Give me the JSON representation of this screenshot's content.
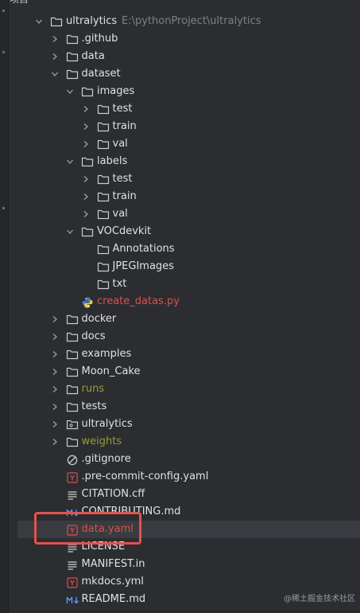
{
  "top_cut_text": "项目",
  "root": {
    "name": "ultralytics",
    "path": "E:\\pythonProject\\ultralytics"
  },
  "items": [
    {
      "label": "ultralytics",
      "hint": "E:\\pythonProject\\ultralytics",
      "depth": 0,
      "chevron": "down",
      "icon": "folder",
      "style": "normal"
    },
    {
      "label": ".github",
      "depth": 1,
      "chevron": "right",
      "icon": "folder",
      "style": "normal"
    },
    {
      "label": "data",
      "depth": 1,
      "chevron": "right",
      "icon": "folder",
      "style": "normal"
    },
    {
      "label": "dataset",
      "depth": 1,
      "chevron": "down",
      "icon": "folder",
      "style": "normal"
    },
    {
      "label": "images",
      "depth": 2,
      "chevron": "down",
      "icon": "folder",
      "style": "normal"
    },
    {
      "label": "test",
      "depth": 3,
      "chevron": "right",
      "icon": "folder",
      "style": "normal"
    },
    {
      "label": "train",
      "depth": 3,
      "chevron": "right",
      "icon": "folder",
      "style": "normal"
    },
    {
      "label": "val",
      "depth": 3,
      "chevron": "right",
      "icon": "folder",
      "style": "normal"
    },
    {
      "label": "labels",
      "depth": 2,
      "chevron": "down",
      "icon": "folder",
      "style": "normal"
    },
    {
      "label": "test",
      "depth": 3,
      "chevron": "right",
      "icon": "folder",
      "style": "normal"
    },
    {
      "label": "train",
      "depth": 3,
      "chevron": "right",
      "icon": "folder",
      "style": "normal"
    },
    {
      "label": "val",
      "depth": 3,
      "chevron": "right",
      "icon": "folder",
      "style": "normal"
    },
    {
      "label": "VOCdevkit",
      "depth": 2,
      "chevron": "down",
      "icon": "folder",
      "style": "normal"
    },
    {
      "label": "Annotations",
      "depth": 3,
      "chevron": "none",
      "icon": "folder",
      "style": "normal"
    },
    {
      "label": "JPEGImages",
      "depth": 3,
      "chevron": "none",
      "icon": "folder",
      "style": "normal"
    },
    {
      "label": "txt",
      "depth": 3,
      "chevron": "none",
      "icon": "folder",
      "style": "normal"
    },
    {
      "label": "create_datas.py",
      "depth": 2,
      "chevron": "none",
      "icon": "python",
      "style": "red"
    },
    {
      "label": "docker",
      "depth": 1,
      "chevron": "right",
      "icon": "folder",
      "style": "normal"
    },
    {
      "label": "docs",
      "depth": 1,
      "chevron": "right",
      "icon": "folder",
      "style": "normal"
    },
    {
      "label": "examples",
      "depth": 1,
      "chevron": "right",
      "icon": "folder",
      "style": "normal"
    },
    {
      "label": "Moon_Cake",
      "depth": 1,
      "chevron": "right",
      "icon": "folder",
      "style": "normal"
    },
    {
      "label": "runs",
      "depth": 1,
      "chevron": "right",
      "icon": "folder",
      "style": "olive"
    },
    {
      "label": "tests",
      "depth": 1,
      "chevron": "right",
      "icon": "folder",
      "style": "normal"
    },
    {
      "label": "ultralytics",
      "depth": 1,
      "chevron": "right",
      "icon": "package",
      "style": "normal"
    },
    {
      "label": "weights",
      "depth": 1,
      "chevron": "right",
      "icon": "folder",
      "style": "olive"
    },
    {
      "label": ".gitignore",
      "depth": 1,
      "chevron": "none",
      "icon": "gitignore",
      "style": "normal"
    },
    {
      "label": ".pre-commit-config.yaml",
      "depth": 1,
      "chevron": "none",
      "icon": "yaml",
      "style": "normal"
    },
    {
      "label": "CITATION.cff",
      "depth": 1,
      "chevron": "none",
      "icon": "text",
      "style": "normal"
    },
    {
      "label": "CONTRIBUTING.md",
      "depth": 1,
      "chevron": "none",
      "icon": "markdown",
      "style": "normal"
    },
    {
      "label": "data.yaml",
      "depth": 1,
      "chevron": "none",
      "icon": "yaml",
      "style": "red",
      "selected": true
    },
    {
      "label": "LICENSE",
      "depth": 1,
      "chevron": "none",
      "icon": "text",
      "style": "normal"
    },
    {
      "label": "MANIFEST.in",
      "depth": 1,
      "chevron": "none",
      "icon": "text",
      "style": "normal"
    },
    {
      "label": "mkdocs.yml",
      "depth": 1,
      "chevron": "none",
      "icon": "yaml",
      "style": "normal"
    },
    {
      "label": "README.md",
      "depth": 1,
      "chevron": "none",
      "icon": "markdown",
      "style": "normal"
    }
  ],
  "watermark": "@稀土掘金技术社区",
  "colors": {
    "background": "#2b2d30",
    "text": "#dfe1e5",
    "excluded_olive": "#9a9b3a",
    "modified_red": "#d9524f",
    "highlight_box": "#e0534e",
    "selection": "#393b40"
  }
}
